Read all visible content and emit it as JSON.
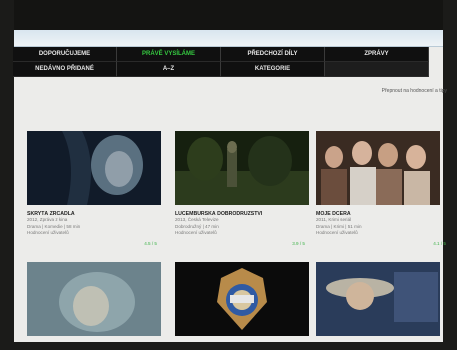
{
  "nav": {
    "items": [
      {
        "label": "Doporučujeme",
        "active": false
      },
      {
        "label": "Právě vysíláme",
        "active": true
      },
      {
        "label": "Předchozí díly",
        "active": false
      },
      {
        "label": "Zprávy",
        "active": false
      },
      {
        "label": "Nedávno přidané",
        "active": false
      },
      {
        "label": "A–Z",
        "active": false
      },
      {
        "label": "Kategorie",
        "active": false
      },
      {
        "label": "",
        "active": false
      }
    ]
  },
  "sort_link": "Přepnout na hodnocení a tipy",
  "videos": [
    {
      "title": "Skrytá zrcadla",
      "meta": [
        "2012, Zpráva z kina",
        "Drama | Komedie | 58 min",
        "Hodnocení uživatelů"
      ],
      "rating": "4.5 / 5"
    },
    {
      "title": "Lucemburská dobrodružství",
      "meta": [
        "2013, Česká Televize",
        "Dobrodružný | 47 min",
        "Hodnocení uživatelů"
      ],
      "rating": "3.9 / 5"
    },
    {
      "title": "Moje dcera",
      "meta": [
        "2011, Krimi seriál",
        "Drama | Krimi | 51 min",
        "Hodnocení uživatelů"
      ],
      "rating": "4.1 / 5"
    }
  ]
}
